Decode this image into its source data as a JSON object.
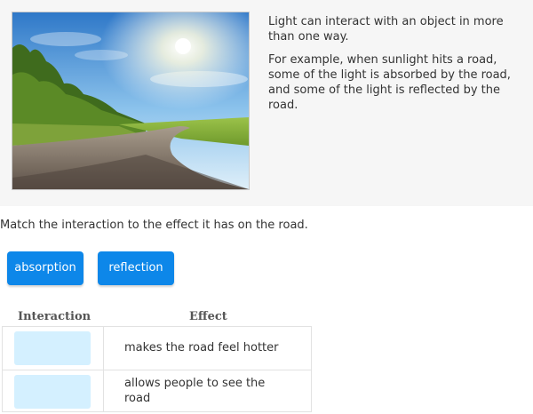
{
  "intro": {
    "paragraph1": "Light can interact with an object in more than one way.",
    "paragraph2": "For example, when sunlight hits a road, some of the light is absorbed by the road, and some of the light is reflected by the road."
  },
  "photo": {
    "description_icon": "sunlit-road-photo"
  },
  "instruction": "Match the interaction to the effect it has on the road.",
  "tiles": [
    {
      "label": "absorption"
    },
    {
      "label": "reflection"
    }
  ],
  "table": {
    "headers": {
      "interaction": "Interaction",
      "effect": "Effect"
    },
    "rows": [
      {
        "effect": "makes the road feel hotter"
      },
      {
        "effect": "allows people to see the road"
      }
    ]
  },
  "colors": {
    "tile_blue": "#0d87e9",
    "drop_target": "#d4f0ff",
    "panel_bg": "#f6f6f6"
  }
}
